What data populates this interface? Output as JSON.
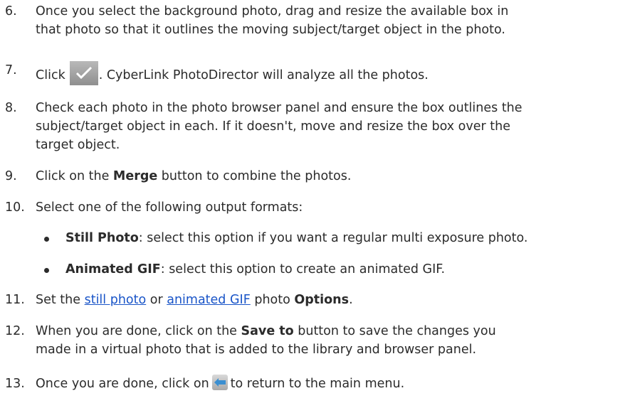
{
  "steps": [
    {
      "num": "6.",
      "lines": [
        "Once you select the background photo, drag and resize the available box in",
        "that photo so that it outlines the moving subject/target object in the photo."
      ]
    },
    {
      "num": "7.",
      "pre": "Click",
      "post": ". CyberLink PhotoDirector will analyze all the photos."
    },
    {
      "num": "8.",
      "lines": [
        "Check each photo in the photo browser panel and ensure the box outlines the",
        "subject/target object in each. If it doesn't, move and resize the box over the",
        "target object."
      ]
    },
    {
      "num": "9.",
      "pre": "Click on the ",
      "bold": "Merge",
      "post": " button to combine the photos."
    },
    {
      "num": "10.",
      "text": "Select one of the following output formats:"
    },
    {
      "num": "11.",
      "pre": "Set the ",
      "link1": "still photo",
      "mid": " or ",
      "link2": "animated GIF",
      "mid2": " photo ",
      "bold": "Options",
      "post": "."
    },
    {
      "num": "12.",
      "pre": "When you are done, click on the ",
      "bold": "Save to",
      "post": " button to save the changes you",
      "line2": "made in a virtual photo that is added to the library and browser panel."
    },
    {
      "num": "13.",
      "pre": "Once you are done, click on",
      "post": "to return to the main menu."
    }
  ],
  "bullets": [
    {
      "bold": "Still Photo",
      "text": ": select this option if you want a regular multi exposure photo."
    },
    {
      "bold": "Animated GIF",
      "text": ": select this option to create an animated GIF."
    }
  ],
  "icons": {
    "apply": "checkmark-icon",
    "back": "back-arrow-icon"
  }
}
